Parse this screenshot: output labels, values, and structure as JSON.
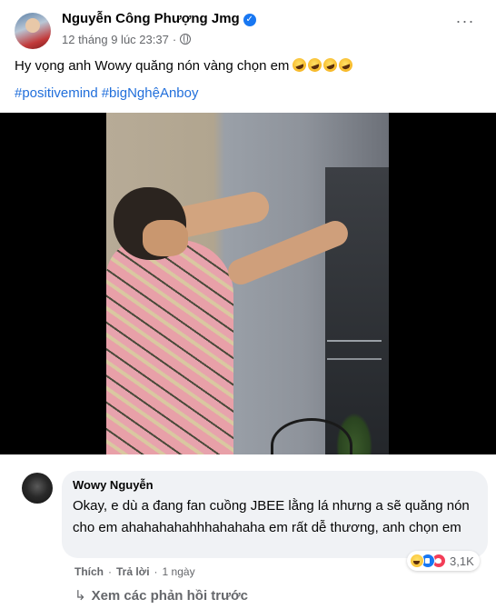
{
  "post": {
    "author": "Nguyễn Công Phượng Jmg",
    "verified": true,
    "timestamp": "12 tháng 9 lúc 23:37",
    "separator": "·",
    "privacy_icon": "globe-icon",
    "more_icon": "ellipsis-icon",
    "more_label": "···",
    "text": "Hy vọng anh Wowy quăng nón vàng chọn em",
    "emojis": [
      "laughing-emoji",
      "laughing-emoji",
      "laughing-emoji",
      "laughing-emoji"
    ],
    "hashtags": [
      "#positivemind",
      "#bigNghệAnboy"
    ]
  },
  "video": {
    "type": "video-player"
  },
  "comment": {
    "author": "Wowy Nguyễn",
    "text": "Okay, e dù a đang fan cuồng JBEE lằng lá nhưng a sẽ quăng nón cho em ahahahahahhhahahaha em rất dễ thương, anh chọn em",
    "reactions": [
      "haha",
      "like",
      "love"
    ],
    "reaction_count": "3,1K",
    "actions": {
      "like": "Thích",
      "reply": "Trả lời",
      "separator": "·",
      "time": "1 ngày"
    }
  },
  "view_previous": {
    "icon": "reply-arrow-icon",
    "arrow": "↳",
    "label": "Xem các phản hồi trước"
  },
  "colors": {
    "link_blue": "#216fdb",
    "secondary_text": "#65676b",
    "bubble_bg": "#f0f2f5",
    "verified_blue": "#1877f2"
  }
}
